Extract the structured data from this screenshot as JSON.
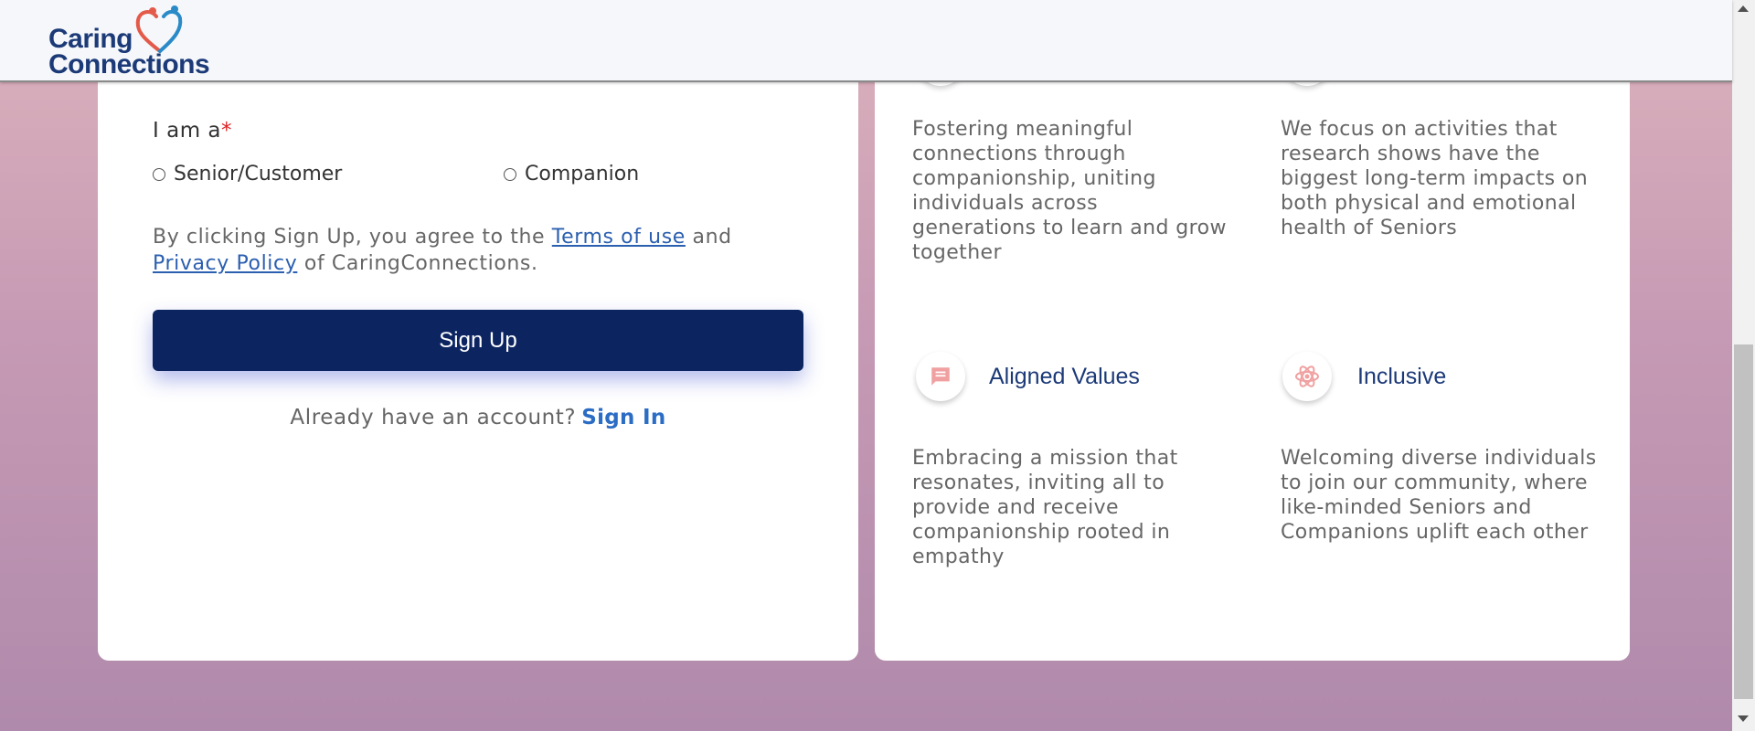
{
  "header": {
    "logo_line1": "Caring",
    "logo_line2": "Connections"
  },
  "signup_form": {
    "role_label": "I am a",
    "required_mark": "*",
    "role_options": [
      "Senior/Customer",
      "Companion"
    ],
    "terms_prefix": "By clicking Sign Up, you agree to the ",
    "terms_link": "Terms of use",
    "terms_and": " and",
    "privacy_link": "Privacy Policy",
    "terms_suffix": " of CaringConnections.",
    "signup_button": "Sign Up",
    "already_text": "Already have an account?",
    "signin_link": "Sign In"
  },
  "features": [
    {
      "title": "",
      "description": "Fostering meaningful connections through companionship, uniting individuals across generations to learn and grow together"
    },
    {
      "title": "",
      "description": "We focus on activities that research shows have the biggest long-term impacts on both physical and emotional health of Seniors"
    },
    {
      "title": "Aligned Values",
      "icon": "chat-icon",
      "description": "Embracing a mission that resonates, inviting all to provide and receive companionship rooted in empathy"
    },
    {
      "title": "Inclusive",
      "icon": "atom-icon",
      "description": "Welcoming diverse individuals to join our community, where like-minded Seniors and Companions uplift each other"
    }
  ],
  "colors": {
    "brand_navy": "#0c2561",
    "link_blue": "#2b5fb0",
    "icon_pink": "#f0a0a0",
    "logo_heart_red": "#e45a4a",
    "logo_heart_blue": "#2a8ac8"
  }
}
